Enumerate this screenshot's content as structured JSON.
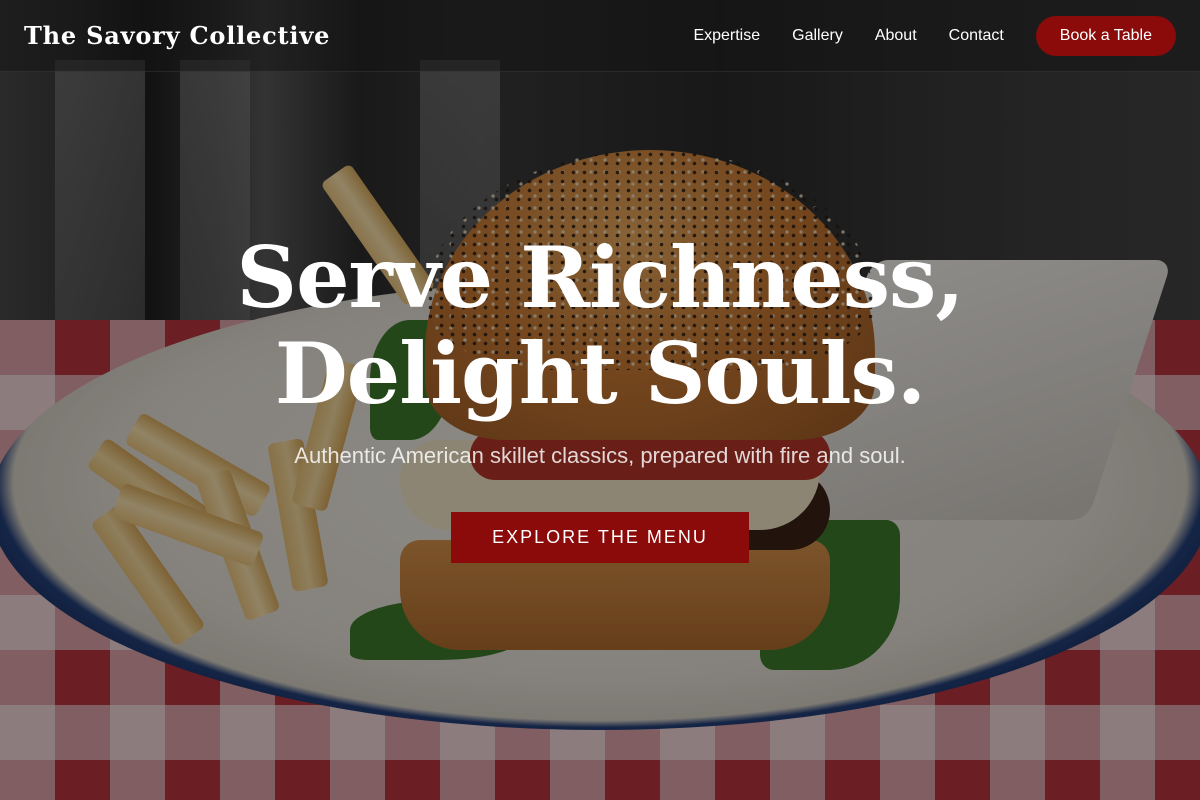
{
  "nav": {
    "brand": "The Savory Collective",
    "links": [
      "Expertise",
      "Gallery",
      "About",
      "Contact"
    ],
    "cta": "Book a Table"
  },
  "hero": {
    "title_line1": "Serve Richness,",
    "title_line2": "Delight Souls.",
    "subtitle": "Authentic American skillet classics, prepared with fire and soul.",
    "button": "EXPLORE THE MENU",
    "background_image": "burger-and-fries-on-plate-photo"
  },
  "colors": {
    "accent": "#8b0a0a",
    "text": "#ffffff",
    "nav_bg": "rgba(20,20,20,0.55)"
  }
}
